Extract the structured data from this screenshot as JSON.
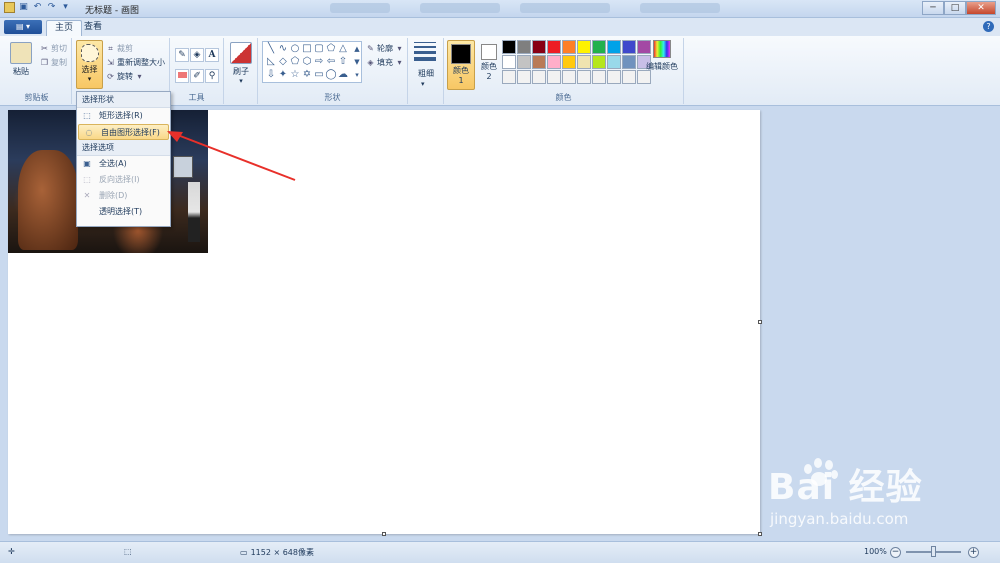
{
  "window": {
    "title": "无标题 - 画图",
    "controls": {
      "minimize": "─",
      "maximize": "□",
      "close": "✕"
    }
  },
  "qat": {
    "icons": [
      "paint-app-icon",
      "save-icon",
      "undo-icon",
      "redo-icon",
      "customize-icon"
    ]
  },
  "tabs": [
    {
      "label": "主页",
      "active": true
    },
    {
      "label": "查看",
      "active": false
    }
  ],
  "ribbon": {
    "clipboard": {
      "label": "剪贴板",
      "paste": "粘贴",
      "cut": "剪切",
      "copy": "复制"
    },
    "image": {
      "select": "选择",
      "crop": "裁剪",
      "resize": "重新调整大小",
      "rotate": "旋转"
    },
    "tools": {
      "label": "工具"
    },
    "brushes": {
      "label": "刷子"
    },
    "shapes": {
      "label": "形状",
      "outline": "轮廓",
      "fill": "填充"
    },
    "size": {
      "label": "粗细"
    },
    "colors": {
      "label": "颜色",
      "color1": "颜色 1",
      "color2": "颜色 2",
      "edit": "编辑颜色",
      "color1_value": "#000000",
      "color2_value": "#ffffff",
      "palette": [
        "#000000",
        "#7f7f7f",
        "#880015",
        "#ed1c24",
        "#ff7f27",
        "#fff200",
        "#22b14c",
        "#00a2e8",
        "#3f48cc",
        "#a349a4",
        "#ffffff",
        "#c3c3c3",
        "#b97a57",
        "#ffaec9",
        "#ffc90e",
        "#efe4b0",
        "#b5e61d",
        "#99d9ea",
        "#7092be",
        "#c8bfe7",
        "#f2f2f2",
        "#f2f2f2",
        "#f2f2f2",
        "#f2f2f2",
        "#f2f2f2",
        "#f2f2f2",
        "#f2f2f2",
        "#f2f2f2",
        "#f2f2f2",
        "#f2f2f2"
      ]
    }
  },
  "select_menu": {
    "shape_header": "选择形状",
    "rect": "矩形选择(R)",
    "freeform": "自由图形选择(F)",
    "options_header": "选择选项",
    "select_all": "全选(A)",
    "invert": "反向选择(I)",
    "delete": "删除(D)",
    "transparent": "透明选择(T)"
  },
  "status": {
    "size": "1152 × 648像素",
    "zoom": "100%"
  },
  "watermark": {
    "brand": "Bai 经验",
    "url": "jingyan.baidu.com"
  }
}
